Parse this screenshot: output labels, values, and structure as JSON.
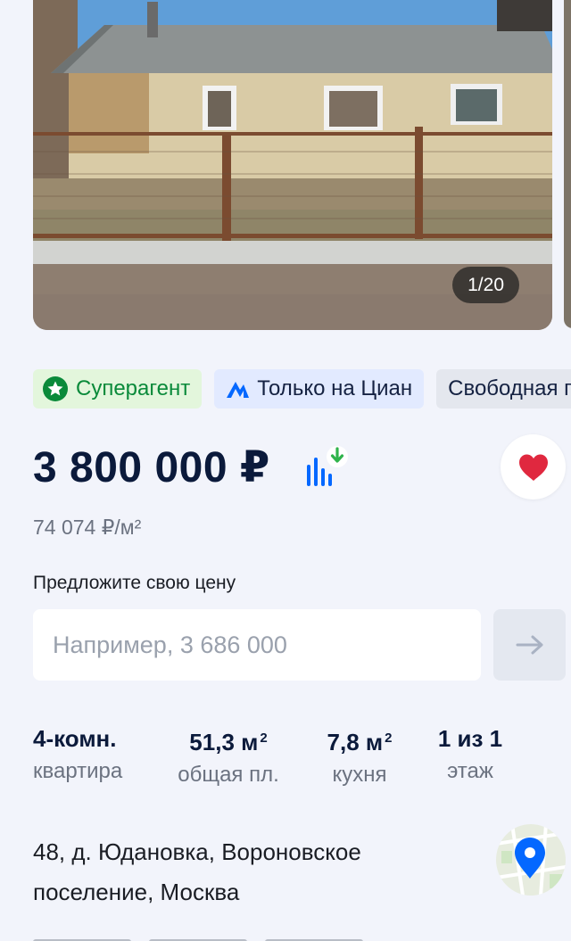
{
  "gallery": {
    "counter": "1/20"
  },
  "badges": [
    {
      "label": "Суперагент",
      "icon": "star-icon"
    },
    {
      "label": "Только на Циан",
      "icon": "cian-logo-icon"
    },
    {
      "label": "Свободная продажа"
    }
  ],
  "price": {
    "value": "3 800 000 ₽",
    "per_sqm": "74 074 ₽/м²",
    "chart_icon": "price-chart-icon",
    "favorite_icon": "heart-icon",
    "favorite_color": "#e0283f"
  },
  "offer": {
    "label": "Предложите свою цену",
    "placeholder": "Например, 3 686 000",
    "submit_icon": "arrow-right-icon"
  },
  "params": [
    {
      "value": "4-комн.",
      "label": "квартира"
    },
    {
      "value": "51,3 м",
      "sup": "2",
      "label": "общая пл."
    },
    {
      "value": "7,8 м",
      "sup": "2",
      "label": "кухня"
    },
    {
      "value": "1 из 1",
      "label": "этаж"
    }
  ],
  "address": {
    "text": "48, д. Юдановка, Вороновское поселение, Москва",
    "map_icon": "map-pin-icon",
    "pin_color": "#0468ff"
  },
  "colors": {
    "accent": "#0468ff",
    "superagent_green": "#0a8a3a",
    "background": "#f2f4fb"
  }
}
